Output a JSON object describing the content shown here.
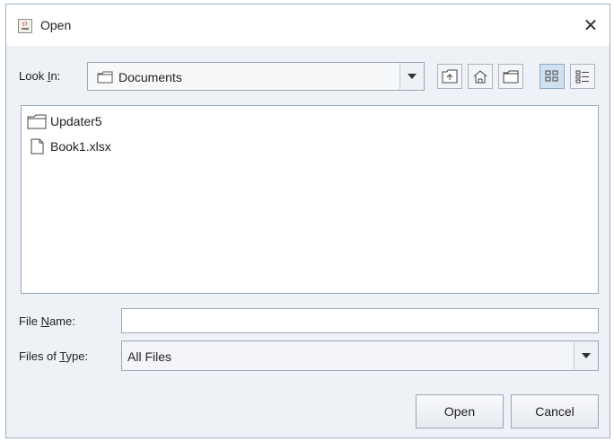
{
  "window": {
    "title": "Open",
    "close_symbol": "✕"
  },
  "toolbar": {
    "look_in_label_pre": "Look ",
    "look_in_label_mnemonic": "I",
    "look_in_label_post": "n:",
    "look_in_value": "Documents",
    "buttons": [
      "up-one-level-icon",
      "home-icon",
      "new-folder-icon",
      "list-view-icon",
      "details-view-icon"
    ]
  },
  "files": [
    {
      "name": "Updater5",
      "type": "folder"
    },
    {
      "name": "Book1.xlsx",
      "type": "file"
    }
  ],
  "form": {
    "file_name_label_pre": "File ",
    "file_name_label_mnemonic": "N",
    "file_name_label_post": "ame:",
    "file_name_value": "",
    "files_of_type_label_pre": "Files of ",
    "files_of_type_label_mnemonic": "T",
    "files_of_type_label_post": "ype:",
    "files_of_type_value": "All Files"
  },
  "buttons": {
    "open": "Open",
    "cancel": "Cancel"
  },
  "colors": {
    "dialog_bg": "#eef1f5",
    "active_toggle": "#cfe0f0",
    "border": "#9aa7b5"
  }
}
